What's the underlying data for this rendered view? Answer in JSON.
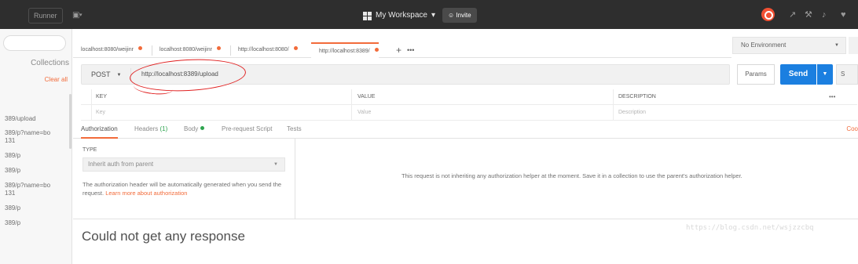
{
  "topbar": {
    "runner_label": "Runner",
    "workspace_label": "My Workspace",
    "workspace_caret": "▾",
    "invite_label": "Invite"
  },
  "sidebar": {
    "collections_label": "Collections",
    "clear_all_label": "Clear all",
    "history": [
      "389/upload",
      "389/p?name=bo",
      "131",
      "389/p",
      "389/p",
      "389/p?name=bo",
      "131",
      "389/p",
      "389/p"
    ]
  },
  "tabs": [
    {
      "label": "localhost:8080/weijinr"
    },
    {
      "label": "localhost:8080/weijinr"
    },
    {
      "label": "http://localhost:8080/"
    },
    {
      "label": "http://localhost:8389/"
    }
  ],
  "tabs_more": "•••",
  "environment": {
    "selected": "No Environment"
  },
  "request": {
    "method": "POST",
    "url": "http://localhost:8389/upload",
    "params_label": "Params",
    "send_label": "Send",
    "save_stub": "S"
  },
  "params_table": {
    "headers": [
      "KEY",
      "VALUE",
      "DESCRIPTION"
    ],
    "placeholders": [
      "Key",
      "Value",
      "Description"
    ],
    "more": "•••"
  },
  "sub_tabs": {
    "authorization": "Authorization",
    "headers": "Headers",
    "headers_count": "(1)",
    "body": "Body",
    "pre_request": "Pre-request Script",
    "tests": "Tests",
    "cookies_stub": "Coo"
  },
  "auth": {
    "type_label": "TYPE",
    "type_value": "Inherit auth from parent",
    "help_text": "The authorization header will be automatically generated when you send the request.",
    "help_link": "Learn more about authorization",
    "message": "This request is not inheriting any authorization helper at the moment. Save it in a collection to use the parent's authorization helper."
  },
  "response": {
    "message": "Could not get any response"
  },
  "watermark": "https://blog.csdn.net/wsjzzcbq",
  "colors": {
    "accent": "#f26b3a",
    "send_blue": "#1b7fe0",
    "annotation_red": "#e02020"
  }
}
